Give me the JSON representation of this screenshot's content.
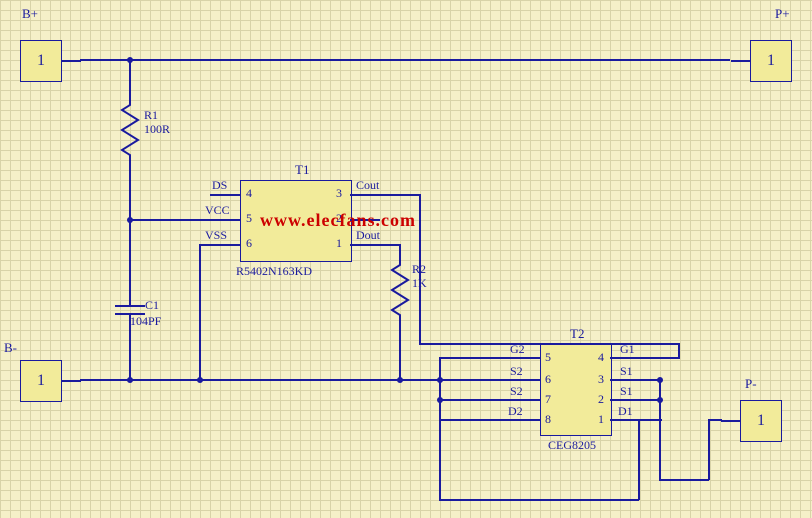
{
  "ports": {
    "bp": {
      "label": "B+",
      "pin": "1"
    },
    "bm": {
      "label": "B-",
      "pin": "1"
    },
    "pp": {
      "label": "P+",
      "pin": "1"
    },
    "pm": {
      "label": "P-",
      "pin": "1"
    }
  },
  "r1": {
    "ref": "R1",
    "val": "100R"
  },
  "r2": {
    "ref": "R2",
    "val": "1K"
  },
  "c1": {
    "ref": "C1",
    "val": "104PF"
  },
  "t1": {
    "ref": "T1",
    "part": "R5402N163KD",
    "pins": {
      "ds": {
        "num": "4",
        "name": "DS"
      },
      "vcc": {
        "num": "5",
        "name": "VCC"
      },
      "vss": {
        "num": "6",
        "name": "VSS"
      },
      "cout": {
        "num": "3",
        "name": "Cout"
      },
      "blank": {
        "num": "2",
        "name": ""
      },
      "dout": {
        "num": "1",
        "name": "Dout"
      }
    }
  },
  "t2": {
    "ref": "T2",
    "part": "CEG8205",
    "pins": {
      "g2": {
        "num": "5",
        "name": "G2"
      },
      "s2a": {
        "num": "6",
        "name": "S2"
      },
      "s2b": {
        "num": "7",
        "name": "S2"
      },
      "d2": {
        "num": "8",
        "name": "D2"
      },
      "g1": {
        "num": "4",
        "name": "G1"
      },
      "s1a": {
        "num": "3",
        "name": "S1"
      },
      "s1b": {
        "num": "2",
        "name": "S1"
      },
      "d1": {
        "num": "1",
        "name": "D1"
      }
    }
  },
  "watermark": "www.elecfans.com"
}
